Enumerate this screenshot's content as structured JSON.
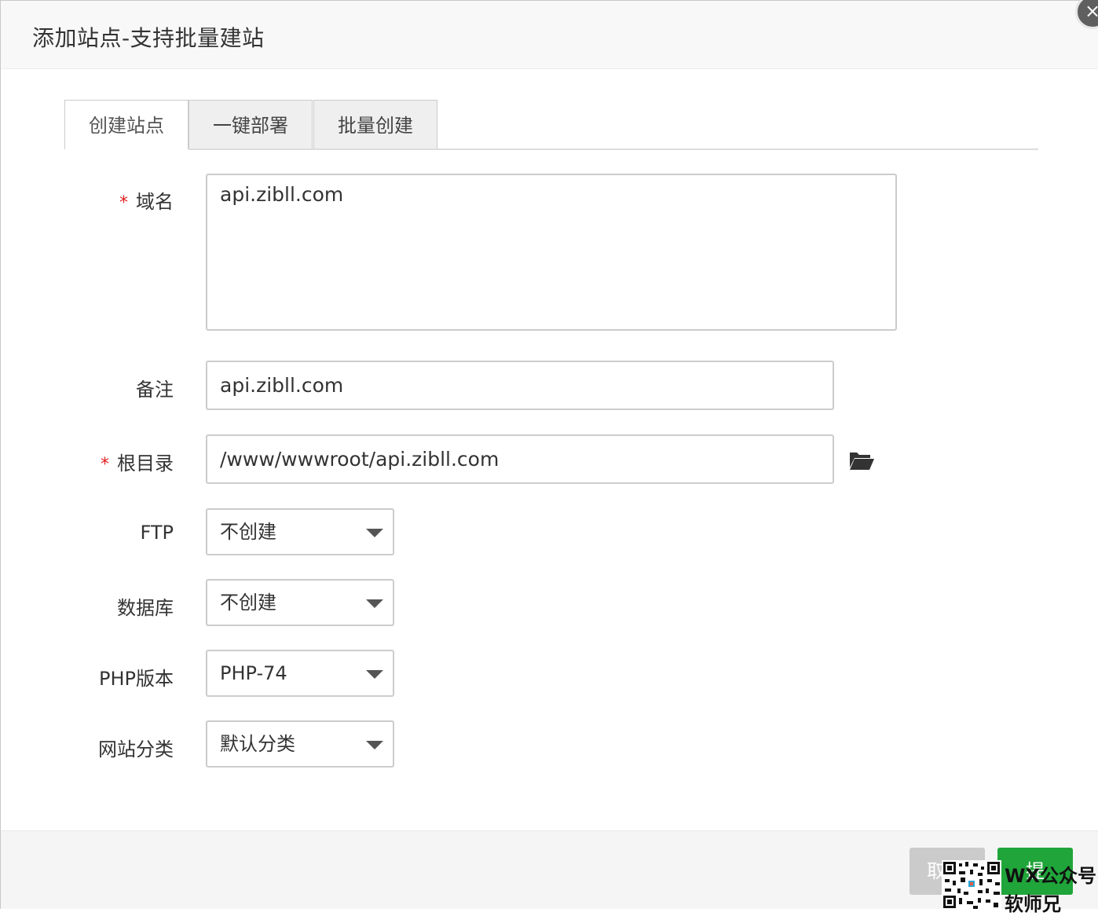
{
  "dialog": {
    "title": "添加站点-支持批量建站",
    "close_glyph": "×"
  },
  "tabs": [
    {
      "label": "创建站点",
      "active": true
    },
    {
      "label": "一键部署",
      "active": false
    },
    {
      "label": "批量创建",
      "active": false
    }
  ],
  "form": {
    "domain": {
      "label": "域名",
      "required_mark": "*",
      "value": "api.zibll.com"
    },
    "remark": {
      "label": "备注",
      "value": "api.zibll.com"
    },
    "root_dir": {
      "label": "根目录",
      "required_mark": "*",
      "value": "/www/wwwroot/api.zibll.com",
      "browse_icon": "folder-open-icon"
    },
    "ftp": {
      "label": "FTP",
      "selected": "不创建"
    },
    "database": {
      "label": "数据库",
      "selected": "不创建"
    },
    "php_version": {
      "label": "PHP版本",
      "selected": "PHP-74"
    },
    "site_category": {
      "label": "网站分类",
      "selected": "默认分类"
    }
  },
  "footer": {
    "cancel_label": "取",
    "submit_label": "提",
    "submit_color": "#20a53a"
  },
  "watermark": {
    "line1": "WX公众号",
    "line2": "软师兄"
  }
}
